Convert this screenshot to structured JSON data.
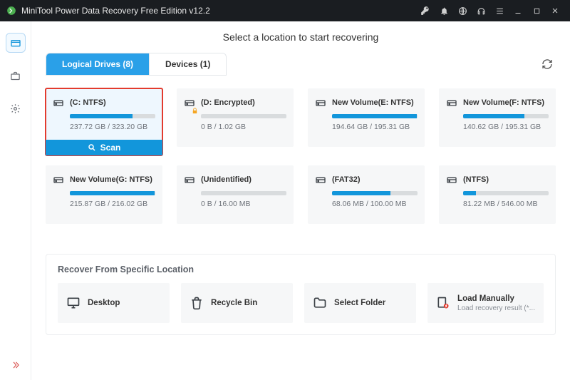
{
  "titlebar": {
    "title": "MiniTool Power Data Recovery Free Edition v12.2"
  },
  "pageTitle": "Select a location to start recovering",
  "tabs": {
    "logical": "Logical Drives (8)",
    "devices": "Devices (1)"
  },
  "scanLabel": "Scan",
  "drives": [
    {
      "name": "(C: NTFS)",
      "size": "237.72 GB / 323.20 GB",
      "pct": 73,
      "selected": true,
      "locked": false
    },
    {
      "name": "(D: Encrypted)",
      "size": "0 B / 1.02 GB",
      "pct": 0,
      "selected": false,
      "locked": true
    },
    {
      "name": "New Volume(E: NTFS)",
      "size": "194.64 GB / 195.31 GB",
      "pct": 99,
      "selected": false,
      "locked": false
    },
    {
      "name": "New Volume(F: NTFS)",
      "size": "140.62 GB / 195.31 GB",
      "pct": 72,
      "selected": false,
      "locked": false
    },
    {
      "name": "New Volume(G: NTFS)",
      "size": "215.87 GB / 216.02 GB",
      "pct": 99,
      "selected": false,
      "locked": false
    },
    {
      "name": "(Unidentified)",
      "size": "0 B / 16.00 MB",
      "pct": 0,
      "selected": false,
      "locked": false
    },
    {
      "name": "(FAT32)",
      "size": "68.06 MB / 100.00 MB",
      "pct": 68,
      "selected": false,
      "locked": false
    },
    {
      "name": "(NTFS)",
      "size": "81.22 MB / 546.00 MB",
      "pct": 15,
      "selected": false,
      "locked": false
    }
  ],
  "section": {
    "title": "Recover From Specific Location",
    "items": [
      {
        "label": "Desktop",
        "sub": "",
        "icon": "desktop"
      },
      {
        "label": "Recycle Bin",
        "sub": "",
        "icon": "recycle"
      },
      {
        "label": "Select Folder",
        "sub": "",
        "icon": "folder"
      },
      {
        "label": "Load Manually",
        "sub": "Load recovery result (*...",
        "icon": "load"
      }
    ]
  }
}
